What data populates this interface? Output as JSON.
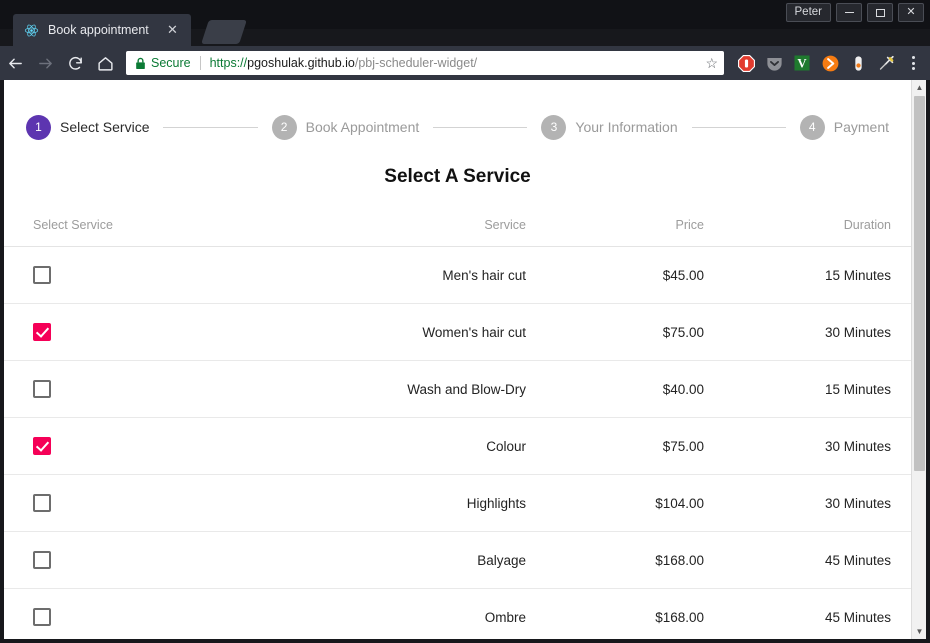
{
  "window": {
    "user_label": "Peter",
    "minimize_label": "—",
    "maximize_label": "□",
    "close_label": "✕"
  },
  "browser": {
    "tab": {
      "title": "Book appointment",
      "favicon": "react-logo-icon",
      "close_label": "✕"
    },
    "new_tab_label": "+",
    "nav": {
      "back": "back-arrow-icon",
      "forward": "forward-arrow-icon",
      "reload": "reload-icon",
      "home": "home-icon"
    },
    "omnibox": {
      "security_label": "Secure",
      "url_scheme": "https://",
      "url_host": "pgoshulak.github.io",
      "url_path": "/pbj-scheduler-widget/",
      "bookmark_label": "☆"
    },
    "extensions": [
      {
        "name": "adblock-icon"
      },
      {
        "name": "pocket-icon"
      },
      {
        "name": "vimium-icon",
        "label": "V"
      },
      {
        "name": "forward-orange-icon"
      },
      {
        "name": "pill-icon"
      },
      {
        "name": "syringe-icon"
      }
    ],
    "menu_label": "chrome-menu-icon"
  },
  "page": {
    "stepper": [
      {
        "number": "1",
        "label": "Select Service",
        "state": "active"
      },
      {
        "number": "2",
        "label": "Book Appointment",
        "state": "inactive"
      },
      {
        "number": "3",
        "label": "Your Information",
        "state": "inactive"
      },
      {
        "number": "4",
        "label": "Payment",
        "state": "inactive"
      }
    ],
    "heading": "Select A Service",
    "table": {
      "headers": {
        "select": "Select Service",
        "service": "Service",
        "price": "Price",
        "duration": "Duration"
      },
      "rows": [
        {
          "checked": false,
          "service": "Men's hair cut",
          "price": "$45.00",
          "duration": "15 Minutes"
        },
        {
          "checked": true,
          "service": "Women's hair cut",
          "price": "$75.00",
          "duration": "30 Minutes"
        },
        {
          "checked": false,
          "service": "Wash and Blow-Dry",
          "price": "$40.00",
          "duration": "15 Minutes"
        },
        {
          "checked": true,
          "service": "Colour",
          "price": "$75.00",
          "duration": "30 Minutes"
        },
        {
          "checked": false,
          "service": "Highlights",
          "price": "$104.00",
          "duration": "30 Minutes"
        },
        {
          "checked": false,
          "service": "Balyage",
          "price": "$168.00",
          "duration": "45 Minutes"
        },
        {
          "checked": false,
          "service": "Ombre",
          "price": "$168.00",
          "duration": "45 Minutes"
        }
      ]
    },
    "scrollbar": {
      "up_label": "▲",
      "down_label": "▼"
    }
  },
  "colors": {
    "accent_purple": "#5d35b0",
    "checkbox_pink": "#f50057",
    "secure_green": "#0b7a35",
    "chrome_toolbar": "#323641"
  }
}
